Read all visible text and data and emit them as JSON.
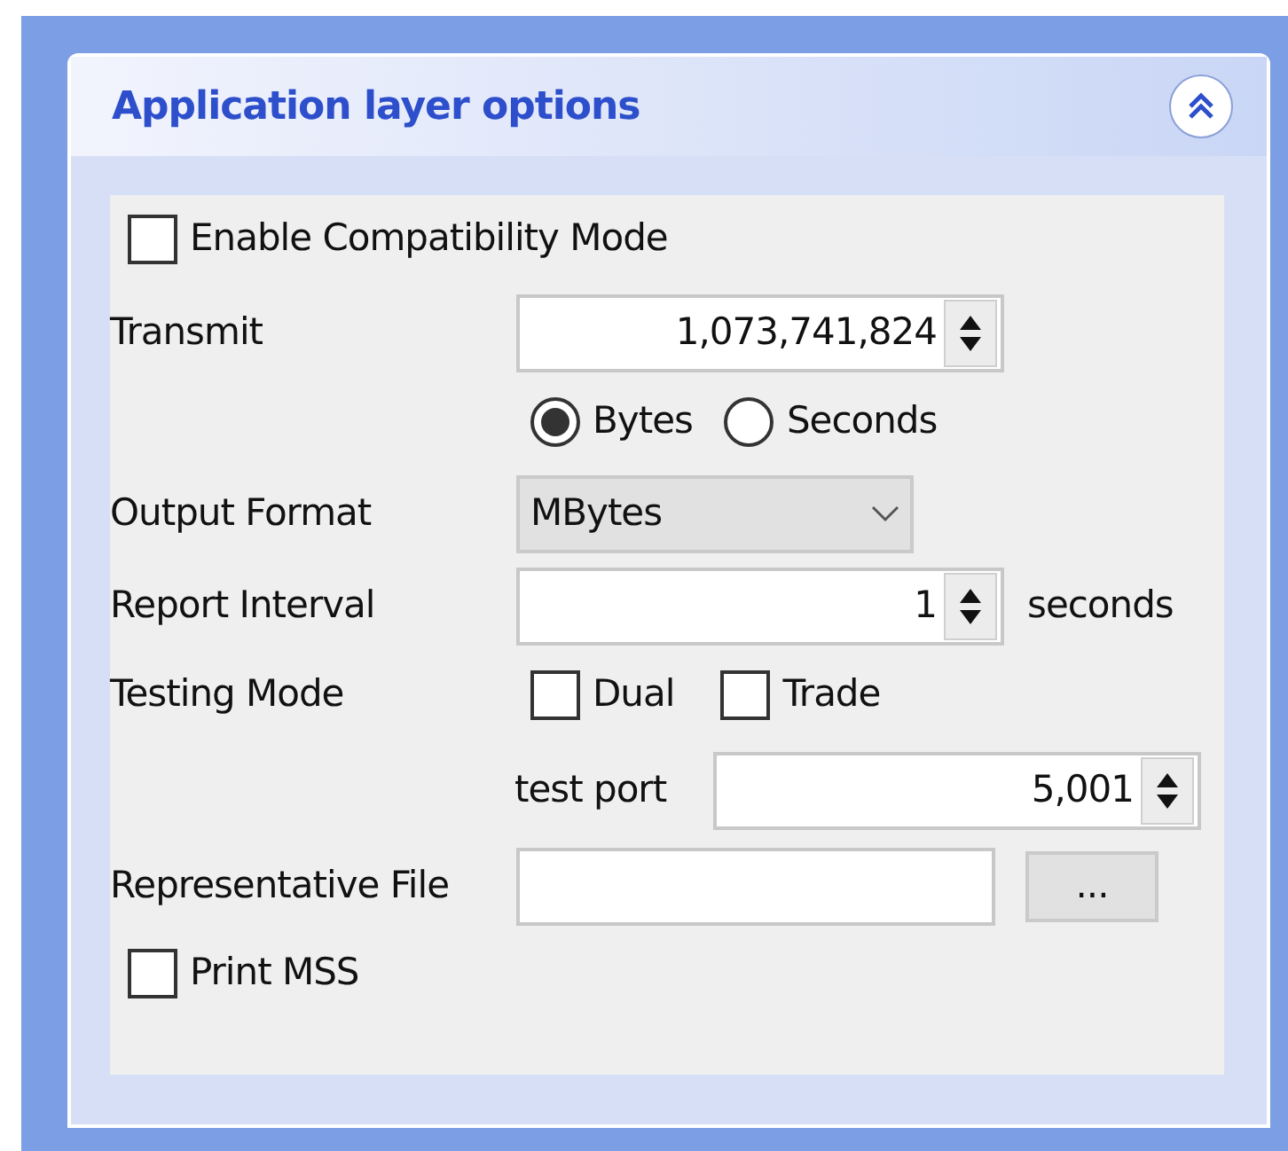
{
  "panel": {
    "title": "Application layer options",
    "expanded": true
  },
  "compatibility": {
    "label": "Enable Compatibility Mode",
    "checked": false
  },
  "transmit": {
    "label": "Transmit",
    "value": "1,073,741,824"
  },
  "unit": [
    {
      "label": "Bytes",
      "selected": true
    },
    {
      "label": "Seconds",
      "selected": false
    }
  ],
  "output_format": {
    "label": "Output Format",
    "value": "MBytes"
  },
  "report_interval": {
    "label": "Report Interval",
    "value": "1",
    "unit": "seconds"
  },
  "testing_mode": {
    "label": "Testing Mode",
    "options": [
      {
        "label": "Dual",
        "checked": false
      },
      {
        "label": "Trade",
        "checked": false
      }
    ]
  },
  "test_port": {
    "label": "test port",
    "value": "5,001"
  },
  "representative_file": {
    "label": "Representative File",
    "button": "..."
  },
  "print_mss": {
    "label": "Print MSS",
    "checked": false
  }
}
